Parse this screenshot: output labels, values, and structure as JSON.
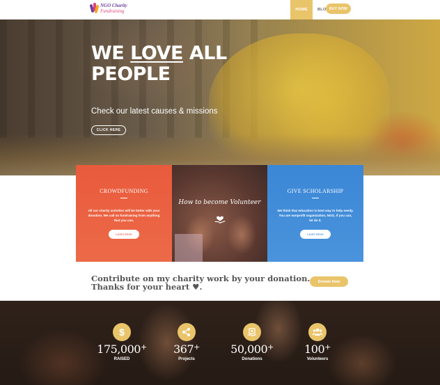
{
  "header": {
    "logo_line1": "NGO Charity",
    "logo_line2": "Fundraising",
    "nav": [
      {
        "label": "HOME",
        "active": true
      },
      {
        "label": "BLOG ▾",
        "active": false
      }
    ],
    "buy_label": "BUY NOW"
  },
  "hero": {
    "title_we": "WE",
    "title_love": "LOVE",
    "title_all": "ALL",
    "title_line2": "PEOPLE",
    "subtitle": "Check our latest causes & missions",
    "button_label": "CLICK HERE"
  },
  "cards": [
    {
      "title": "CROWDFUNDING",
      "text": "All our charity activities will be better with your donation. We call on fundraising from anything that you can.",
      "button": "Learn More",
      "color": "#e95a3c"
    },
    {
      "title": "How to become Volunteer"
    },
    {
      "title": "GIVE SCHOLARSHIP",
      "text": "We think that education is best way to help needy. You are nonprofit organization, NGO, if you can, let do it.",
      "button": "Learn More",
      "color": "#3b87d6"
    }
  ],
  "contribute": {
    "line1": "Contribute on my charity work by your donation.",
    "line2": "Thanks for your heart ♥.",
    "button": "Donate Now"
  },
  "stats": [
    {
      "value": "175,000",
      "plus": "+",
      "label": "RAISED",
      "icon": "dollar-icon"
    },
    {
      "value": "367",
      "plus": "+",
      "label": "Projects",
      "icon": "share-icon"
    },
    {
      "value": "50,000",
      "plus": "+",
      "label": "Donations",
      "icon": "donation-icon"
    },
    {
      "value": "100",
      "plus": "+",
      "label": "Volunteers",
      "icon": "people-icon"
    }
  ],
  "colors": {
    "accent": "#e9c46a",
    "orange_card": "#e95a3c",
    "blue_card": "#3b87d6"
  }
}
